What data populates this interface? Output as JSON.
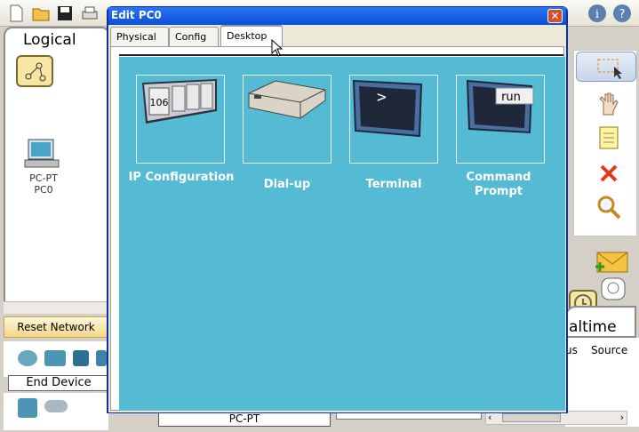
{
  "app": {
    "logical_tab_label": "Logical",
    "reset_network_label": "Reset Network",
    "device_category_label": "End Device",
    "selected_device_model": "PC-PT",
    "realtime_tab_label": "altime",
    "sim_columns": [
      "us",
      "Source"
    ]
  },
  "workspace": {
    "devices": [
      {
        "model": "PC-PT",
        "name": "PC0"
      }
    ]
  },
  "dialog": {
    "title": "Edit PC0",
    "close_glyph": "✕",
    "tabs": [
      "Physical",
      "Config",
      "Desktop"
    ],
    "active_tab": "Desktop"
  },
  "desktop": {
    "apps": [
      {
        "id": "ip-configuration",
        "label": "IP Configuration",
        "icon_text": "106"
      },
      {
        "id": "dial-up",
        "label": "Dial-up",
        "icon_text": ""
      },
      {
        "id": "terminal",
        "label": "Terminal",
        "icon_text": ">"
      },
      {
        "id": "command-prompt",
        "label": "Command Prompt",
        "icon_text": "run"
      }
    ]
  },
  "colors": {
    "desktop_background": "#55bbd5",
    "titlebar": "#0a50d8",
    "active_tab_accent": "#f0b035"
  }
}
